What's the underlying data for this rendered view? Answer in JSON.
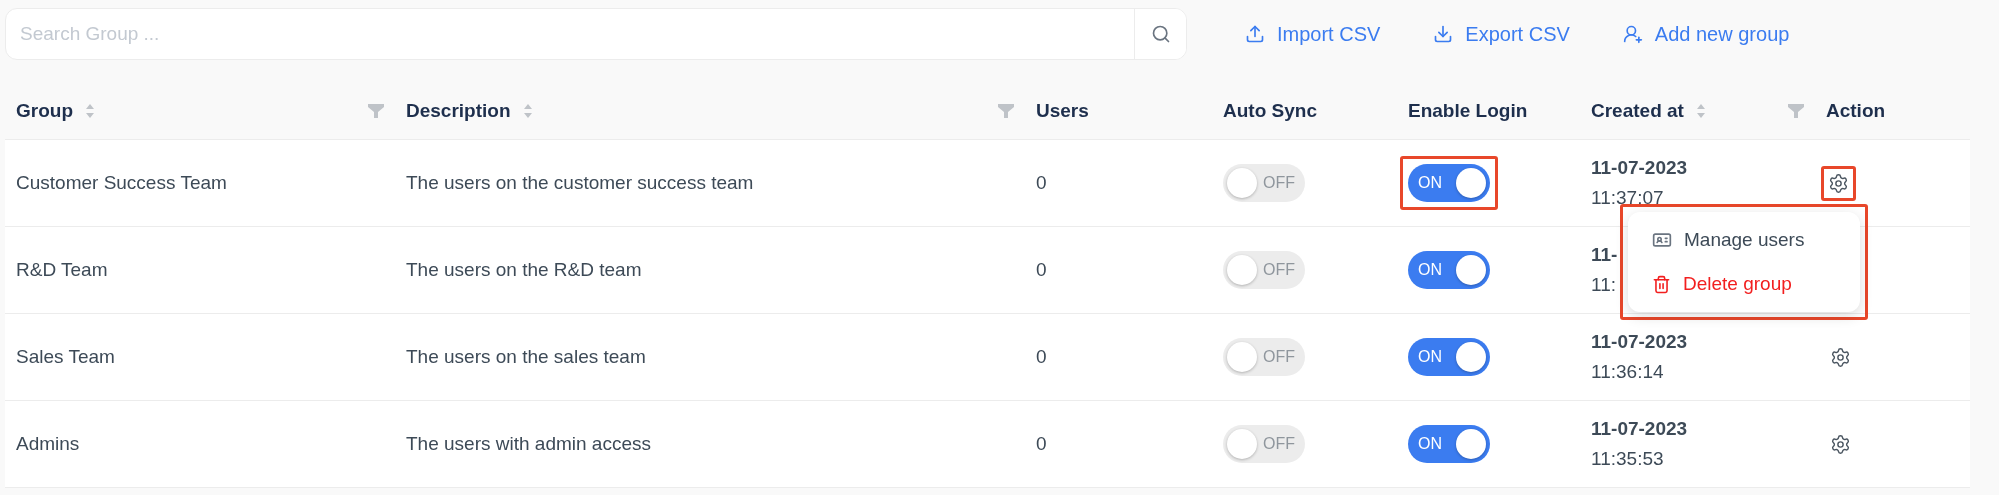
{
  "search": {
    "placeholder": "Search Group ..."
  },
  "actions": [
    {
      "label": "Import CSV",
      "kind": "import"
    },
    {
      "label": "Export CSV",
      "kind": "export"
    },
    {
      "label": "Add new group",
      "kind": "add"
    }
  ],
  "columns": [
    {
      "label": "Group",
      "sortable": true,
      "filterable": true
    },
    {
      "label": "Description",
      "sortable": true,
      "filterable": true
    },
    {
      "label": "Users",
      "sortable": false,
      "filterable": false
    },
    {
      "label": "Auto Sync",
      "sortable": false,
      "filterable": false
    },
    {
      "label": "Enable Login",
      "sortable": false,
      "filterable": false
    },
    {
      "label": "Created at",
      "sortable": true,
      "filterable": true
    },
    {
      "label": "Action",
      "sortable": false,
      "filterable": false
    }
  ],
  "rows": [
    {
      "group": "Customer Success Team",
      "description": "The users on the customer success team",
      "users": "0",
      "auto_sync": {
        "on": false,
        "label": "OFF"
      },
      "enable_login": {
        "on": true,
        "label": "ON",
        "highlighted": true
      },
      "date": "11-07-2023",
      "time": "11:37:07",
      "action_icon": true,
      "action_highlighted": true
    },
    {
      "group": "R&D Team",
      "description": "The users on the R&D team",
      "users": "0",
      "auto_sync": {
        "on": false,
        "label": "OFF"
      },
      "enable_login": {
        "on": true,
        "label": "ON",
        "highlighted": false
      },
      "date": "11-",
      "time": "11:",
      "action_icon": false
    },
    {
      "group": "Sales Team",
      "description": "The users on the sales team",
      "users": "0",
      "auto_sync": {
        "on": false,
        "label": "OFF"
      },
      "enable_login": {
        "on": true,
        "label": "ON",
        "highlighted": false
      },
      "date": "11-07-2023",
      "time": "11:36:14",
      "action_icon": true,
      "action_highlighted": false
    },
    {
      "group": "Admins",
      "description": "The users with admin access",
      "users": "0",
      "auto_sync": {
        "on": false,
        "label": "OFF"
      },
      "enable_login": {
        "on": true,
        "label": "ON",
        "highlighted": false
      },
      "date": "11-07-2023",
      "time": "11:35:53",
      "action_icon": true,
      "action_highlighted": false
    }
  ],
  "menu": {
    "highlighted": true,
    "items": [
      {
        "label": "Manage users",
        "kind": "manage"
      },
      {
        "label": "Delete group",
        "kind": "danger"
      }
    ]
  }
}
